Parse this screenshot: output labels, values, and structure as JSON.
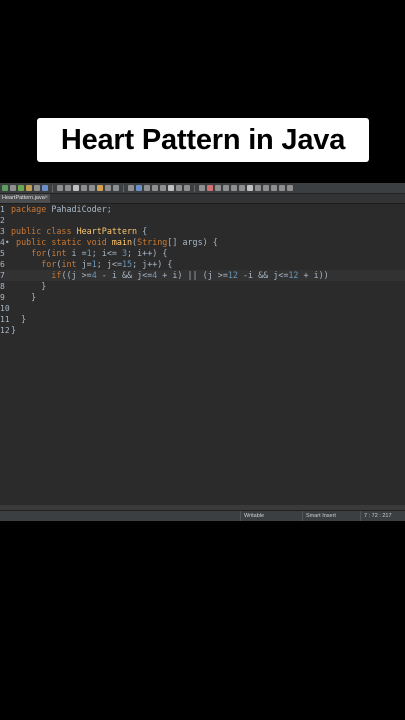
{
  "title_card": {
    "text": "Heart Pattern in Java"
  },
  "toolbar": {
    "icons": [
      "run-icon",
      "debug-icon",
      "build-icon",
      "save-icon",
      "search-icon",
      "open-icon",
      "refresh-icon",
      "layout-icon",
      "nav-back-icon",
      "nav-forward-icon"
    ],
    "colors": [
      "#5c9e5c",
      "#8f8f8f",
      "#6aa84f",
      "#c0a050",
      "#8f8f8f",
      "#6a8ec8",
      "#8f8f8f",
      "#8f8f8f",
      "#c0c0c0",
      "#8f8f8f",
      "#8f8f8f",
      "#d0a050",
      "#8f8f8f",
      "#8f8f8f",
      "#8f8f8f",
      "#6a8ec8",
      "#8f8f8f",
      "#8f8f8f",
      "#8f8f8f",
      "#c0c0c0",
      "#8f8f8f",
      "#8f8f8f",
      "#8f8f8f",
      "#d07070",
      "#8f8f8f",
      "#8f8f8f",
      "#8f8f8f",
      "#8f8f8f",
      "#c0c0c0",
      "#8f8f8f",
      "#8f8f8f",
      "#8f8f8f",
      "#8f8f8f",
      "#8f8f8f"
    ]
  },
  "editor_tab": {
    "label": "HeartPattern.java",
    "close": "×"
  },
  "code_lines": [
    {
      "n": "1",
      "parts": [
        [
          "kw",
          "package"
        ],
        [
          "",
          " PahadiCoder;"
        ]
      ]
    },
    {
      "n": "2",
      "parts": []
    },
    {
      "n": "3",
      "parts": [
        [
          "kw",
          "public class"
        ],
        [
          "",
          " "
        ],
        [
          "cls",
          "HeartPattern"
        ],
        [
          "",
          " {"
        ]
      ]
    },
    {
      "n": "4•",
      "parts": [
        [
          "",
          " "
        ],
        [
          "kw",
          "public static void"
        ],
        [
          "",
          " "
        ],
        [
          "cls",
          "main"
        ],
        [
          "",
          "("
        ],
        [
          "kw",
          "String"
        ],
        [
          "",
          "[] args) {"
        ]
      ]
    },
    {
      "n": "5",
      "parts": [
        [
          "",
          "    "
        ],
        [
          "kw",
          "for"
        ],
        [
          "",
          "("
        ],
        [
          "kw",
          "int"
        ],
        [
          "",
          " i ="
        ],
        [
          "num",
          "1"
        ],
        [
          "",
          "; i<= "
        ],
        [
          "num",
          "3"
        ],
        [
          "",
          "; i++) {"
        ]
      ]
    },
    {
      "n": "6",
      "parts": [
        [
          "",
          "      "
        ],
        [
          "kw",
          "for"
        ],
        [
          "",
          "("
        ],
        [
          "kw",
          "int"
        ],
        [
          "",
          " j="
        ],
        [
          "num",
          "1"
        ],
        [
          "",
          "; j<="
        ],
        [
          "num",
          "15"
        ],
        [
          "",
          "; j++) {"
        ]
      ]
    },
    {
      "n": "7",
      "parts": [
        [
          "",
          "        "
        ],
        [
          "kw",
          "if"
        ],
        [
          "",
          "((j >="
        ],
        [
          "num",
          "4"
        ],
        [
          "",
          " - i && j<="
        ],
        [
          "num",
          "4"
        ],
        [
          "",
          " + i) || (j >="
        ],
        [
          "num",
          "12"
        ],
        [
          "",
          " -i && j<="
        ],
        [
          "num",
          "12"
        ],
        [
          "",
          " + i))"
        ]
      ]
    },
    {
      "n": "8",
      "parts": [
        [
          "",
          "      }"
        ]
      ]
    },
    {
      "n": "9",
      "parts": [
        [
          "",
          "    }"
        ]
      ]
    },
    {
      "n": "10",
      "parts": []
    },
    {
      "n": "11",
      "parts": [
        [
          "",
          "  }"
        ]
      ]
    },
    {
      "n": "12",
      "parts": [
        [
          "",
          "}"
        ]
      ]
    }
  ],
  "status": {
    "writable": "Writable",
    "insert_mode": "Smart Insert",
    "position": "7 : 72 : 217"
  }
}
